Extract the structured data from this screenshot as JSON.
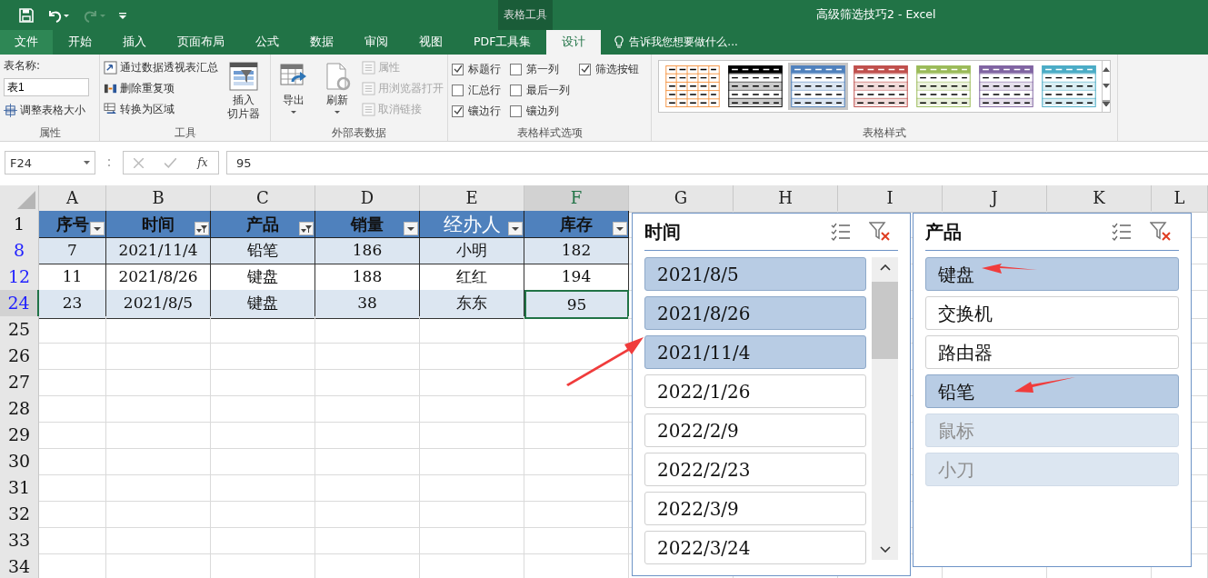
{
  "title_bar": {
    "context_group": "表格工具",
    "title": "高级筛选技巧2 - Excel"
  },
  "ribbon_tabs": [
    {
      "label": "文件",
      "kind": "file",
      "selected": false
    },
    {
      "label": "开始",
      "kind": "tab",
      "selected": false
    },
    {
      "label": "插入",
      "kind": "tab",
      "selected": false
    },
    {
      "label": "页面布局",
      "kind": "tab",
      "selected": false
    },
    {
      "label": "公式",
      "kind": "tab",
      "selected": false
    },
    {
      "label": "数据",
      "kind": "tab",
      "selected": false
    },
    {
      "label": "审阅",
      "kind": "tab",
      "selected": false
    },
    {
      "label": "视图",
      "kind": "tab",
      "selected": false
    },
    {
      "label": "PDF工具集",
      "kind": "tab",
      "selected": false
    },
    {
      "label": "设计",
      "kind": "tab",
      "selected": true
    }
  ],
  "tell_me": "告诉我您想要做什么...",
  "properties_group": {
    "name_label": "表名称:",
    "table_name": "表1",
    "resize": "调整表格大小",
    "label": "属性"
  },
  "tools_group": {
    "items": [
      {
        "label": "通过数据透视表汇总",
        "disabled": false
      },
      {
        "label": "删除重复项",
        "disabled": false
      },
      {
        "label": "转换为区域",
        "disabled": false
      }
    ],
    "slicer": "插入切片器",
    "label": "工具"
  },
  "external_group": {
    "large": [
      {
        "label": "导出"
      },
      {
        "label": "刷新"
      }
    ],
    "items": [
      {
        "label": "属性",
        "disabled": true
      },
      {
        "label": "用浏览器打开",
        "disabled": true
      },
      {
        "label": "取消链接",
        "disabled": true
      }
    ],
    "label": "外部表数据"
  },
  "style_options_group": {
    "columns": [
      [
        {
          "label": "标题行",
          "checked": true
        },
        {
          "label": "汇总行",
          "checked": false
        },
        {
          "label": "镶边行",
          "checked": true
        }
      ],
      [
        {
          "label": "第一列",
          "checked": false
        },
        {
          "label": "最后一列",
          "checked": false
        },
        {
          "label": "镶边列",
          "checked": false
        }
      ],
      [
        {
          "label": "筛选按钮",
          "checked": true
        }
      ]
    ],
    "label": "表格样式选项"
  },
  "styles_group": {
    "swatches": [
      {
        "kind": "grid",
        "color": "#f79646",
        "selected": false
      },
      {
        "kind": "banded",
        "color": "#000000",
        "selected": false
      },
      {
        "kind": "banded",
        "color": "#4f81bd",
        "selected": true
      },
      {
        "kind": "banded",
        "color": "#c0504d",
        "selected": false
      },
      {
        "kind": "banded",
        "color": "#9bbb59",
        "selected": false
      },
      {
        "kind": "banded",
        "color": "#8064a2",
        "selected": false
      },
      {
        "kind": "banded",
        "color": "#4bacc6",
        "selected": false
      }
    ],
    "label": "表格样式"
  },
  "formula_bar": {
    "name_box": "F24",
    "function_label": "fx",
    "formula": "95"
  },
  "sheet": {
    "columns": [
      {
        "label": "A",
        "selected": false
      },
      {
        "label": "B",
        "selected": false
      },
      {
        "label": "C",
        "selected": false
      },
      {
        "label": "D",
        "selected": false
      },
      {
        "label": "E",
        "selected": false
      },
      {
        "label": "F",
        "selected": true
      },
      {
        "label": "G",
        "selected": false
      },
      {
        "label": "H",
        "selected": false
      },
      {
        "label": "I",
        "selected": false
      },
      {
        "label": "J",
        "selected": false
      },
      {
        "label": "K",
        "selected": false
      },
      {
        "label": "L",
        "selected": false
      }
    ],
    "header_row": {
      "number": "1",
      "cells": [
        {
          "label": "序号",
          "filtered": false,
          "light_text": false
        },
        {
          "label": "时间",
          "filtered": true,
          "light_text": false
        },
        {
          "label": "产品",
          "filtered": true,
          "light_text": false
        },
        {
          "label": "销量",
          "filtered": false,
          "light_text": false
        },
        {
          "label": "经办人",
          "filtered": false,
          "light_text": true
        },
        {
          "label": "库存",
          "filtered": false,
          "light_text": false
        }
      ]
    },
    "rows": [
      {
        "number": "8",
        "filtered": true,
        "banded": true,
        "selected": false,
        "cells": [
          "7",
          "2021/11/4",
          "铅笔",
          "186",
          "小明",
          "182"
        ]
      },
      {
        "number": "12",
        "filtered": true,
        "banded": false,
        "selected": false,
        "cells": [
          "11",
          "2021/8/26",
          "键盘",
          "188",
          "红红",
          "194"
        ]
      },
      {
        "number": "24",
        "filtered": true,
        "banded": true,
        "selected": true,
        "cells": [
          "23",
          "2021/8/5",
          "键盘",
          "38",
          "东东",
          "95"
        ]
      }
    ],
    "empty_rows": [
      "25",
      "26",
      "27",
      "28",
      "29",
      "30",
      "31",
      "32",
      "33",
      "34"
    ]
  },
  "slicers": [
    {
      "title": "时间",
      "scrollbar": true,
      "items": [
        {
          "label": "2021/8/5",
          "selected": true,
          "disabled": false
        },
        {
          "label": "2021/8/26",
          "selected": true,
          "disabled": false
        },
        {
          "label": "2021/11/4",
          "selected": true,
          "disabled": false
        },
        {
          "label": "2022/1/26",
          "selected": false,
          "disabled": false
        },
        {
          "label": "2022/2/9",
          "selected": false,
          "disabled": false
        },
        {
          "label": "2022/2/23",
          "selected": false,
          "disabled": false
        },
        {
          "label": "2022/3/9",
          "selected": false,
          "disabled": false
        },
        {
          "label": "2022/3/24",
          "selected": false,
          "disabled": false
        }
      ]
    },
    {
      "title": "产品",
      "scrollbar": false,
      "items": [
        {
          "label": "键盘",
          "selected": true,
          "disabled": false
        },
        {
          "label": "交换机",
          "selected": false,
          "disabled": false
        },
        {
          "label": "路由器",
          "selected": false,
          "disabled": false
        },
        {
          "label": "铅笔",
          "selected": true,
          "disabled": false
        },
        {
          "label": "鼠标",
          "selected": false,
          "disabled": true
        },
        {
          "label": "小刀",
          "selected": false,
          "disabled": true
        }
      ]
    }
  ]
}
